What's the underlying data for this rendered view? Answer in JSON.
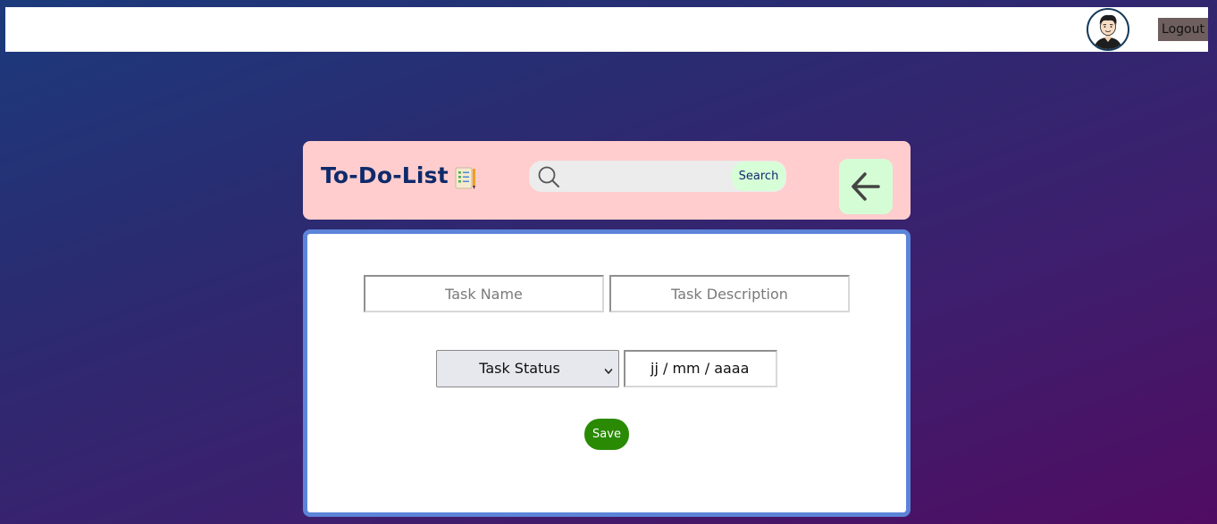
{
  "topbar": {
    "logout_label": "Logout",
    "avatar_icon": "user-avatar-icon"
  },
  "header": {
    "title": "To-Do-List",
    "title_icon": "notepad-icon",
    "search": {
      "placeholder": "",
      "value": "",
      "icon": "search-icon",
      "button_label": "Search"
    },
    "back_icon": "arrow-left-icon"
  },
  "form": {
    "task_name_placeholder": "Task Name",
    "task_description_placeholder": "Task Description",
    "status_select": {
      "selected": "Task Status"
    },
    "date_placeholder": "jj / mm / aaaa",
    "save_label": "Save"
  },
  "colors": {
    "background_gradient": [
      "#1b3a7c",
      "#500c62"
    ],
    "header_bg": "#ffcdcd",
    "title_color": "#0e2a6b",
    "search_button_bg": "#d7ffd7",
    "back_button_bg": "#d5fdd5",
    "form_border": "#5c84d8",
    "save_button_bg": "#2a8a04",
    "logout_bg": "#6e5e5e"
  }
}
